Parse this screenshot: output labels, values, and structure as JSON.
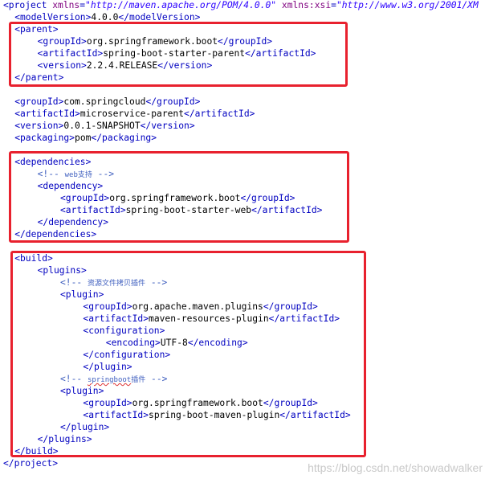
{
  "lines": [
    {
      "indent": 0,
      "segments": [
        {
          "cls": "tag",
          "text": "<project "
        },
        {
          "cls": "attr",
          "text": "xmlns"
        },
        {
          "cls": "tag",
          "text": "="
        },
        {
          "cls": "val",
          "text": "\"http://maven.apache.org/POM/4.0.0\""
        },
        {
          "cls": "tag",
          "text": " "
        },
        {
          "cls": "attr",
          "text": "xmlns:xsi"
        },
        {
          "cls": "tag",
          "text": "="
        },
        {
          "cls": "val",
          "text": "\"http://www.w3.org/2001/XM"
        }
      ]
    },
    {
      "indent": 1,
      "segments": [
        {
          "cls": "tag",
          "text": "<modelVersion>"
        },
        {
          "cls": "txt",
          "text": "4.0.0"
        },
        {
          "cls": "tag",
          "text": "</modelVersion>"
        }
      ]
    },
    {
      "indent": 1,
      "segments": [
        {
          "cls": "tag",
          "text": "<parent>"
        }
      ]
    },
    {
      "indent": 3,
      "segments": [
        {
          "cls": "tag",
          "text": "<groupId>"
        },
        {
          "cls": "txt",
          "text": "org.springframework.boot"
        },
        {
          "cls": "tag",
          "text": "</groupId>"
        }
      ]
    },
    {
      "indent": 3,
      "segments": [
        {
          "cls": "tag",
          "text": "<artifactId>"
        },
        {
          "cls": "txt",
          "text": "spring-boot-starter-parent"
        },
        {
          "cls": "tag",
          "text": "</artifactId>"
        }
      ]
    },
    {
      "indent": 3,
      "segments": [
        {
          "cls": "tag",
          "text": "<version>"
        },
        {
          "cls": "txt",
          "text": "2.2.4.RELEASE"
        },
        {
          "cls": "tag",
          "text": "</version>"
        }
      ]
    },
    {
      "indent": 1,
      "segments": [
        {
          "cls": "tag",
          "text": "</parent>"
        }
      ]
    },
    {
      "indent": 1,
      "segments": []
    },
    {
      "indent": 1,
      "segments": [
        {
          "cls": "tag",
          "text": "<groupId>"
        },
        {
          "cls": "txt",
          "text": "com.springcloud"
        },
        {
          "cls": "tag",
          "text": "</groupId>"
        }
      ]
    },
    {
      "indent": 1,
      "segments": [
        {
          "cls": "tag",
          "text": "<artifactId>"
        },
        {
          "cls": "txt",
          "text": "microservice-parent"
        },
        {
          "cls": "tag",
          "text": "</artifactId>"
        }
      ]
    },
    {
      "indent": 1,
      "segments": [
        {
          "cls": "tag",
          "text": "<version>"
        },
        {
          "cls": "txt",
          "text": "0.0.1-SNAPSHOT"
        },
        {
          "cls": "tag",
          "text": "</version>"
        }
      ]
    },
    {
      "indent": 1,
      "segments": [
        {
          "cls": "tag",
          "text": "<packaging>"
        },
        {
          "cls": "txt",
          "text": "pom"
        },
        {
          "cls": "tag",
          "text": "</packaging>"
        }
      ]
    },
    {
      "indent": 1,
      "segments": []
    },
    {
      "indent": 1,
      "segments": [
        {
          "cls": "tag",
          "text": "<dependencies>"
        }
      ]
    },
    {
      "indent": 3,
      "segments": [
        {
          "cls": "cmt",
          "text": "<!-- "
        },
        {
          "cls": "cmt cmt-small",
          "text": "web支持"
        },
        {
          "cls": "cmt",
          "text": " -->"
        }
      ]
    },
    {
      "indent": 3,
      "segments": [
        {
          "cls": "tag",
          "text": "<dependency>"
        }
      ]
    },
    {
      "indent": 5,
      "segments": [
        {
          "cls": "tag",
          "text": "<groupId>"
        },
        {
          "cls": "txt",
          "text": "org.springframework.boot"
        },
        {
          "cls": "tag",
          "text": "</groupId>"
        }
      ]
    },
    {
      "indent": 5,
      "segments": [
        {
          "cls": "tag",
          "text": "<artifactId>"
        },
        {
          "cls": "txt",
          "text": "spring-boot-starter-web"
        },
        {
          "cls": "tag",
          "text": "</artifactId>"
        }
      ]
    },
    {
      "indent": 3,
      "segments": [
        {
          "cls": "tag",
          "text": "</dependency>"
        }
      ]
    },
    {
      "indent": 1,
      "segments": [
        {
          "cls": "tag",
          "text": "</dependencies>"
        }
      ]
    },
    {
      "indent": 1,
      "segments": []
    },
    {
      "indent": 1,
      "segments": [
        {
          "cls": "tag",
          "text": "<build>"
        }
      ]
    },
    {
      "indent": 3,
      "segments": [
        {
          "cls": "tag",
          "text": "<plugins>"
        }
      ]
    },
    {
      "indent": 5,
      "segments": [
        {
          "cls": "cmt",
          "text": "<!-- "
        },
        {
          "cls": "cmt cmt-small",
          "text": "资源文件拷贝插件"
        },
        {
          "cls": "cmt",
          "text": " -->"
        }
      ]
    },
    {
      "indent": 5,
      "segments": [
        {
          "cls": "tag",
          "text": "<plugin>"
        }
      ]
    },
    {
      "indent": 7,
      "segments": [
        {
          "cls": "tag",
          "text": "<groupId>"
        },
        {
          "cls": "txt",
          "text": "org.apache.maven.plugins"
        },
        {
          "cls": "tag",
          "text": "</groupId>"
        }
      ]
    },
    {
      "indent": 7,
      "segments": [
        {
          "cls": "tag",
          "text": "<artifactId>"
        },
        {
          "cls": "txt",
          "text": "maven-resources-plugin"
        },
        {
          "cls": "tag",
          "text": "</artifactId>"
        }
      ]
    },
    {
      "indent": 7,
      "segments": [
        {
          "cls": "tag",
          "text": "<configuration>"
        }
      ]
    },
    {
      "indent": 9,
      "segments": [
        {
          "cls": "tag",
          "text": "<encoding>"
        },
        {
          "cls": "txt",
          "text": "UTF-8"
        },
        {
          "cls": "tag",
          "text": "</encoding>"
        }
      ]
    },
    {
      "indent": 7,
      "segments": [
        {
          "cls": "tag",
          "text": "</configuration>"
        }
      ]
    },
    {
      "indent": 7,
      "segments": [
        {
          "cls": "tag",
          "text": "</plugin>"
        }
      ]
    },
    {
      "indent": 5,
      "segments": [
        {
          "cls": "cmt",
          "text": "<!-- "
        },
        {
          "cls": "cmt cmt-small squiggle",
          "text": "springboot"
        },
        {
          "cls": "cmt cmt-small",
          "text": "插件"
        },
        {
          "cls": "cmt",
          "text": " -->"
        }
      ]
    },
    {
      "indent": 5,
      "segments": [
        {
          "cls": "tag",
          "text": "<plugin>"
        }
      ]
    },
    {
      "indent": 7,
      "segments": [
        {
          "cls": "tag",
          "text": "<groupId>"
        },
        {
          "cls": "txt",
          "text": "org.springframework.boot"
        },
        {
          "cls": "tag",
          "text": "</groupId>"
        }
      ]
    },
    {
      "indent": 7,
      "segments": [
        {
          "cls": "tag",
          "text": "<artifactId>"
        },
        {
          "cls": "txt",
          "text": "spring-boot-maven-plugin"
        },
        {
          "cls": "tag",
          "text": "</artifactId>"
        }
      ]
    },
    {
      "indent": 5,
      "segments": [
        {
          "cls": "tag",
          "text": "</plugin>"
        }
      ]
    },
    {
      "indent": 3,
      "segments": [
        {
          "cls": "tag",
          "text": "</plugins>"
        }
      ]
    },
    {
      "indent": 1,
      "segments": [
        {
          "cls": "tag",
          "text": "</build>"
        }
      ]
    },
    {
      "indent": 0,
      "segments": [
        {
          "cls": "tag",
          "text": "</project>"
        }
      ]
    }
  ],
  "highlight_boxes": [
    {
      "name": "parent-highlight-box"
    },
    {
      "name": "dependencies-highlight-box"
    },
    {
      "name": "build-highlight-box"
    }
  ],
  "watermark": "https://blog.csdn.net/showadwalker"
}
